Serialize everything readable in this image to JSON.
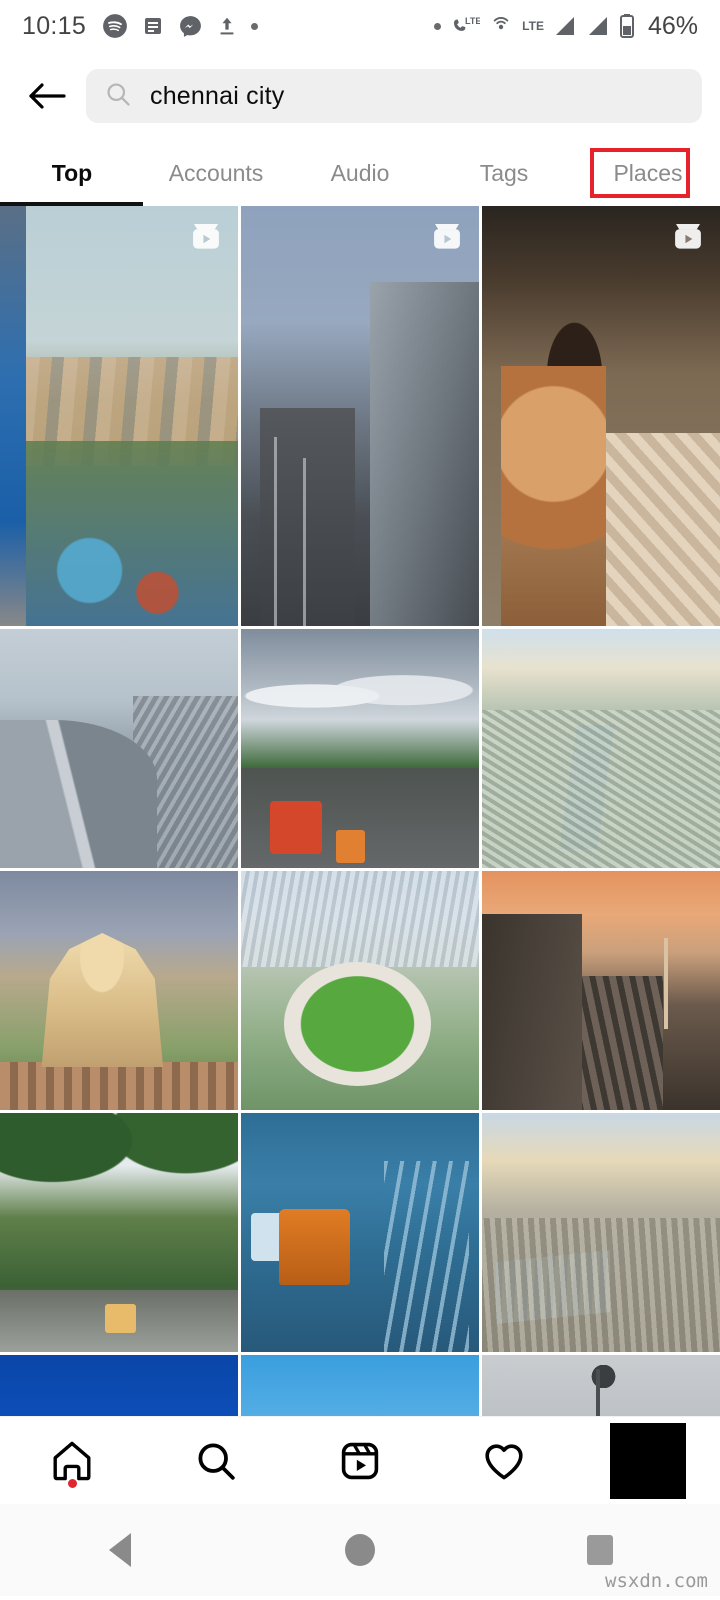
{
  "status_bar": {
    "time": "10:15",
    "left_icons": [
      "spotify-icon",
      "notes-icon",
      "messenger-icon",
      "upload-icon",
      "dot-icon"
    ],
    "right_icons": [
      "dot-icon",
      "phone-lte-icon",
      "hotspot-icon",
      "lte-label",
      "signal-bars-1-icon",
      "signal-bars-2-icon",
      "battery-icon"
    ],
    "lte_label": "LTE",
    "battery_percent": "46%"
  },
  "header": {
    "back_label": "←",
    "search": {
      "value": "chennai city",
      "placeholder": "Search",
      "icon": "search-icon"
    }
  },
  "tabs": {
    "items": [
      {
        "label": "Top",
        "active": true
      },
      {
        "label": "Accounts",
        "active": false
      },
      {
        "label": "Audio",
        "active": false
      },
      {
        "label": "Tags",
        "active": false
      },
      {
        "label": "Places",
        "active": false,
        "highlighted": true
      }
    ],
    "highlight_color": "#e8222b",
    "active_underline_color": "#111111"
  },
  "grid": {
    "rows": [
      {
        "type": "reels",
        "cells": [
          {
            "alt": "aerial view of chennai city skyline with highway and blue rooftops",
            "is_reel": true,
            "art": "p1"
          },
          {
            "alt": "evening flyover and metro rail viaduct with traffic",
            "is_reel": true,
            "art": "p2"
          },
          {
            "alt": "group of young men smiling in front of temple gopuram",
            "is_reel": true,
            "art": "p3"
          }
        ]
      },
      {
        "type": "square",
        "cells": [
          {
            "alt": "curved flyover ramp with dense city traffic",
            "is_reel": false,
            "art": "p4"
          },
          {
            "alt": "wide tree lined avenue with red bus and autorickshaws under cloudy sky",
            "is_reel": false,
            "art": "p5"
          },
          {
            "alt": "aerial view of city with river and greenery",
            "is_reel": false,
            "art": "p6"
          }
        ]
      },
      {
        "type": "square",
        "cells": [
          {
            "alt": "vivekananda house heritage building with gardens",
            "is_reel": false,
            "art": "p7"
          },
          {
            "alt": "aerial view of chepauk cricket stadium in the city",
            "is_reel": false,
            "art": "p8"
          },
          {
            "alt": "napier bridge arches at orange sunset",
            "is_reel": false,
            "art": "p9"
          }
        ]
      },
      {
        "type": "square",
        "cells": [
          {
            "alt": "rainy tree lined road with car headlights",
            "is_reel": false,
            "art": "p10"
          },
          {
            "alt": "flooded road in heavy rain with orange autorickshaws",
            "is_reel": false,
            "art": "p11"
          },
          {
            "alt": "aerial view of railway station sheds and cityscape",
            "is_reel": false,
            "art": "p12"
          }
        ]
      },
      {
        "type": "square-cropped",
        "cells": [
          {
            "alt": "yellow and blue building facade against deep blue sky",
            "is_reel": false,
            "art": "p13"
          },
          {
            "alt": "bright blue sky with white clouds",
            "is_reel": false,
            "art": "p14"
          },
          {
            "alt": "tall floodlight mast against grey overcast clouds",
            "is_reel": false,
            "art": "p15"
          }
        ]
      }
    ],
    "reel_badge_icon": "reel-icon"
  },
  "bottom_nav": {
    "items": [
      {
        "icon": "home-icon",
        "label": "Home",
        "active": true,
        "has_badge": true
      },
      {
        "icon": "search-icon",
        "label": "Search",
        "active": false,
        "has_badge": false
      },
      {
        "icon": "reels-icon",
        "label": "Reels",
        "active": false,
        "has_badge": false
      },
      {
        "icon": "heart-icon",
        "label": "Activity",
        "active": false,
        "has_badge": false
      },
      {
        "icon": "avatar-icon",
        "label": "Profile",
        "active": false,
        "has_badge": false
      }
    ],
    "badge_color": "#e0262f"
  },
  "android_nav": {
    "items": [
      {
        "icon": "back-triangle-icon",
        "label": "Back"
      },
      {
        "icon": "home-circle-icon",
        "label": "Home"
      },
      {
        "icon": "recents-square-icon",
        "label": "Recents"
      }
    ]
  },
  "watermark": {
    "text": "wsxdn.com"
  }
}
